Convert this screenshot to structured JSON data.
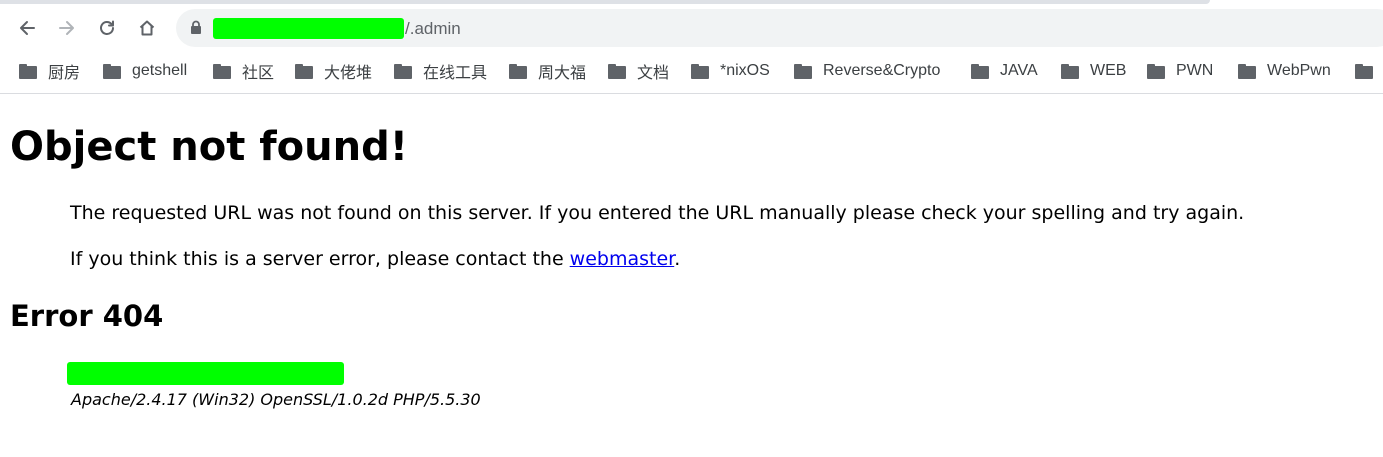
{
  "browser": {
    "url_suffix": "/.admin",
    "url_masked": true,
    "mask_color": "#00ff00",
    "nav_icons": [
      "back-icon",
      "forward-icon",
      "reload-icon",
      "home-icon",
      "lock-icon"
    ],
    "bookmarks": [
      "厨房",
      "getshell",
      "社区",
      "大佬堆",
      "在线工具",
      "周大福",
      "文档",
      "*nixOS",
      "Reverse&Crypto",
      "JAVA",
      "WEB",
      "PWN",
      "WebPwn"
    ]
  },
  "page": {
    "title": "Object not found!",
    "message": "The requested URL was not found on this server. If you entered the URL manually please check your spelling and try again.",
    "contact_prefix": "If you think this is a server error, please contact the ",
    "contact_link": "webmaster",
    "contact_suffix": ".",
    "error_heading": "Error 404",
    "host_masked": true,
    "server_signature": "Apache/2.4.17 (Win32) OpenSSL/1.0.2d PHP/5.5.30"
  }
}
